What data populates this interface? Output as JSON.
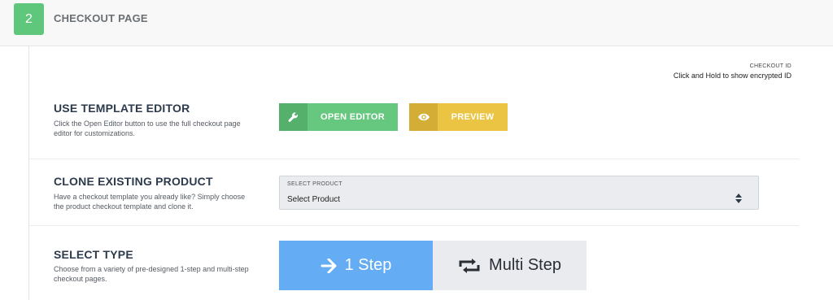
{
  "header": {
    "step_number": "2",
    "title": "CHECKOUT PAGE"
  },
  "checkout_id": {
    "label": "CHECKOUT ID",
    "hint": "Click and Hold to show encrypted ID"
  },
  "template_editor": {
    "title": "USE TEMPLATE EDITOR",
    "description": "Click the Open Editor button to use the full checkout page editor for customizations.",
    "open_editor_label": "OPEN EDITOR",
    "preview_label": "PREVIEW",
    "colors": {
      "open_editor": "#66c77e",
      "preview": "#ecc443"
    }
  },
  "clone_product": {
    "title": "CLONE EXISTING PRODUCT",
    "description": "Have a checkout template you already like? Simply choose the product checkout template and clone it.",
    "select_label": "SELECT PRODUCT",
    "select_value": "Select Product"
  },
  "select_type": {
    "title": "SELECT TYPE",
    "description": "Choose from a variety of pre-designed 1-step and multi-step checkout pages.",
    "one_step_label": "1 Step",
    "multi_step_label": "Multi Step",
    "selected": "1 Step",
    "colors": {
      "selected": "#64adf4",
      "unselected": "#e9ebef"
    }
  },
  "icons": {
    "open_editor": "wrench-icon",
    "preview": "eye-icon",
    "one_step": "arrow-right-icon",
    "multi_step": "repeat-icon",
    "select": "sort-arrows-icon"
  }
}
